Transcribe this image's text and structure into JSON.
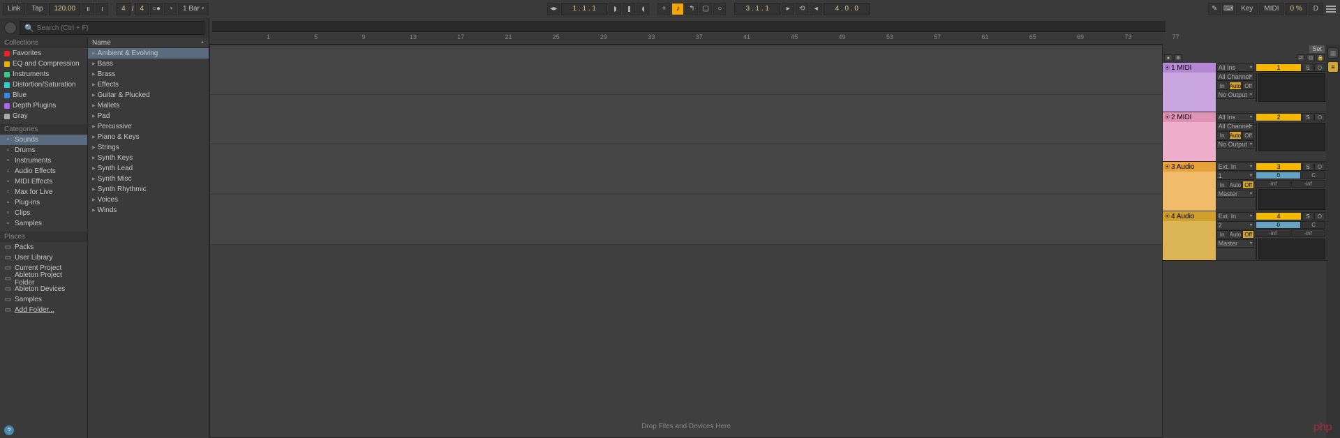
{
  "toolbar": {
    "link": "Link",
    "tap": "Tap",
    "tempo": "120.00",
    "sig_num": "4",
    "sig_sep": "/",
    "sig_den": "4",
    "quantize": "1 Bar",
    "position": "1 .   1 .   1",
    "loop_start": "3 .   1 .   1",
    "loop_len": "4 .   0 .   0",
    "key": "Key",
    "midi": "MIDI",
    "cpu": "0 %",
    "overload": "D"
  },
  "search": {
    "placeholder": "Search (Ctrl + F)"
  },
  "collections_header": "Collections",
  "collections": [
    {
      "color": "#e22",
      "label": "Favorites"
    },
    {
      "color": "#e8b000",
      "label": "EQ and Compression"
    },
    {
      "color": "#3c8",
      "label": "Instruments"
    },
    {
      "color": "#2ad0d0",
      "label": "Distortion/Saturation"
    },
    {
      "color": "#38e",
      "label": "Blue"
    },
    {
      "color": "#a6e",
      "label": "Depth Plugins"
    },
    {
      "color": "#aaa",
      "label": "Gray"
    }
  ],
  "categories_header": "Categories",
  "categories": [
    {
      "label": "Sounds",
      "selected": true
    },
    {
      "label": "Drums"
    },
    {
      "label": "Instruments"
    },
    {
      "label": "Audio Effects"
    },
    {
      "label": "MIDI Effects"
    },
    {
      "label": "Max for Live"
    },
    {
      "label": "Plug-ins"
    },
    {
      "label": "Clips"
    },
    {
      "label": "Samples"
    }
  ],
  "places_header": "Places",
  "places": [
    {
      "label": "Packs"
    },
    {
      "label": "User Library"
    },
    {
      "label": "Current Project"
    },
    {
      "label": "Ableton Project Folder"
    },
    {
      "label": "Ableton Devices"
    },
    {
      "label": "Samples"
    },
    {
      "label": "Add Folder...",
      "underline": true
    }
  ],
  "name_header": "Name",
  "sounds": [
    {
      "label": "Ambient & Evolving",
      "selected": true
    },
    {
      "label": "Bass"
    },
    {
      "label": "Brass"
    },
    {
      "label": "Effects"
    },
    {
      "label": "Guitar & Plucked"
    },
    {
      "label": "Mallets"
    },
    {
      "label": "Pad"
    },
    {
      "label": "Percussive"
    },
    {
      "label": "Piano & Keys"
    },
    {
      "label": "Strings"
    },
    {
      "label": "Synth Keys"
    },
    {
      "label": "Synth Lead"
    },
    {
      "label": "Synth Misc"
    },
    {
      "label": "Synth Rhythmic"
    },
    {
      "label": "Voices"
    },
    {
      "label": "Winds"
    }
  ],
  "ruler": [
    "1",
    "5",
    "9",
    "13",
    "17",
    "21",
    "25",
    "29",
    "33",
    "37",
    "41",
    "45",
    "49",
    "53",
    "57",
    "61",
    "65",
    "69",
    "73",
    "77"
  ],
  "set": "Set",
  "drop": "Drop Files and Devices Here",
  "tracks": [
    {
      "name": "1 MIDI",
      "cls": "purple",
      "num": "1",
      "io": {
        "in_type": "All Ins",
        "in_ch": "All Channel",
        "monitor": "Auto",
        "out": "No Output"
      },
      "sends": null
    },
    {
      "name": "2 MIDI",
      "cls": "pink",
      "num": "2",
      "io": {
        "in_type": "All Ins",
        "in_ch": "All Channel",
        "monitor": "Auto",
        "out": "No Output"
      },
      "sends": null
    },
    {
      "name": "3 Audio",
      "cls": "orange",
      "num": "3",
      "io": {
        "in_type": "Ext. In",
        "in_ch": "1",
        "monitor": "Off",
        "out": "Master"
      },
      "sends": {
        "a": "-inf",
        "b": "-inf",
        "pan": "0"
      }
    },
    {
      "name": "4 Audio",
      "cls": "gold",
      "num": "4",
      "io": {
        "in_type": "Ext. In",
        "in_ch": "2",
        "monitor": "Off",
        "out": "Master"
      },
      "sends": {
        "a": "-inf",
        "b": "-inf",
        "pan": "0"
      }
    }
  ],
  "io_btn": {
    "in": "In",
    "auto": "Auto",
    "off": "Off"
  },
  "mixer_labels": {
    "s": "S",
    "c": "C"
  },
  "watermark": "php"
}
